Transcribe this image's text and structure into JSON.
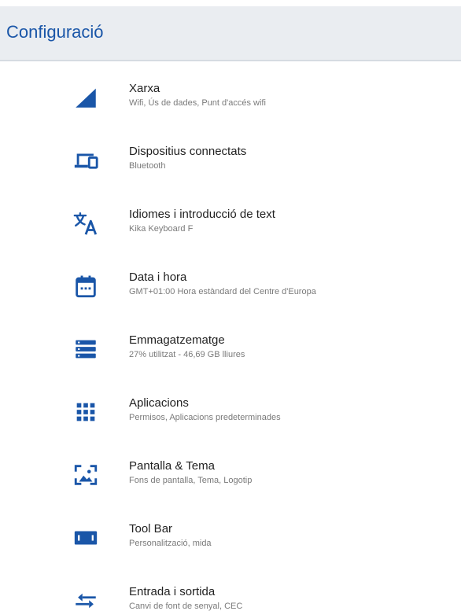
{
  "header": {
    "title": "Configuració"
  },
  "colors": {
    "accent": "#1a56a8",
    "appbar_bg": "#eaedf1",
    "title_text": "#222222",
    "subtitle_text": "#7a7a7a"
  },
  "settings": {
    "items": [
      {
        "icon": "network-signal-icon",
        "title": "Xarxa",
        "subtitle": "Wifi, Ús de dades, Punt d'accés wifi"
      },
      {
        "icon": "connected-devices-icon",
        "title": "Dispositius connectats",
        "subtitle": "Bluetooth"
      },
      {
        "icon": "translate-icon",
        "title": "Idiomes i introducció de text",
        "subtitle": "Kika Keyboard F"
      },
      {
        "icon": "calendar-icon",
        "title": "Data i hora",
        "subtitle": "GMT+01:00 Hora estàndard del Centre d'Europa"
      },
      {
        "icon": "storage-icon",
        "title": "Emmagatzematge",
        "subtitle": "27% utilitzat - 46,69 GB lliures"
      },
      {
        "icon": "apps-grid-icon",
        "title": "Aplicacions",
        "subtitle": "Permisos, Aplicacions predeterminades"
      },
      {
        "icon": "wallpaper-icon",
        "title": "Pantalla & Tema",
        "subtitle": "Fons de pantalla, Tema, Logotip"
      },
      {
        "icon": "toolbar-icon",
        "title": "Tool Bar",
        "subtitle": "Personalització, mida"
      },
      {
        "icon": "input-output-icon",
        "title": "Entrada i sortida",
        "subtitle": "Canvi de font de senyal, CEC"
      }
    ]
  }
}
